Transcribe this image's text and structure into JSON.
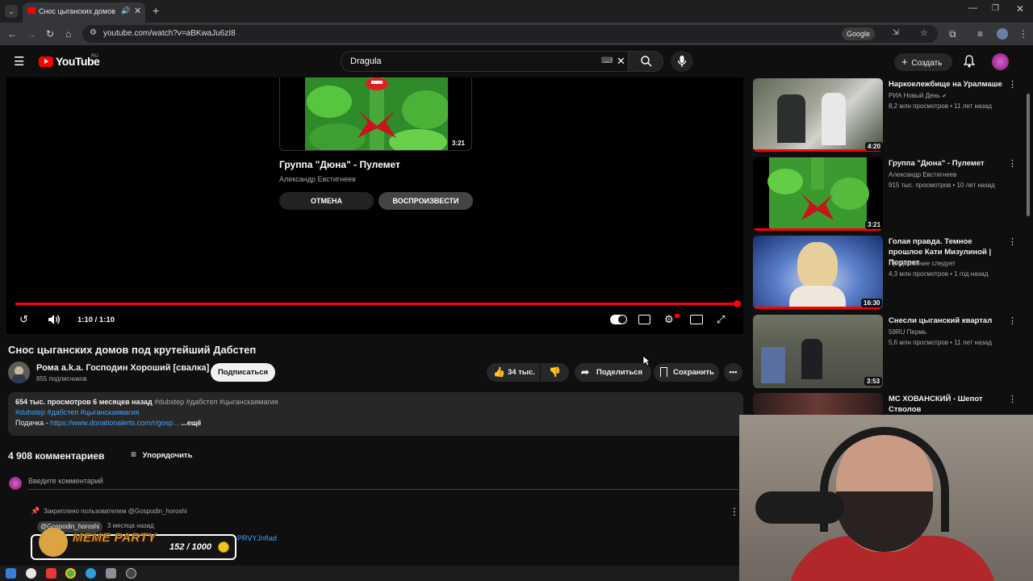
{
  "browser": {
    "tab_title": "Снос цыганских домов по",
    "url": "youtube.com/watch?v=aBKwaJu6zI8",
    "google_label": "Google"
  },
  "header": {
    "logo_text": "YouTube",
    "region": "RU",
    "search_query": "Dragula",
    "create_label": "Создать"
  },
  "player": {
    "endscreen": {
      "duration": "3:21",
      "title": "Группа \"Дюна\" - Пулемет",
      "channel": "Александр Евстигнеев",
      "cancel_label": "ОТМЕНА",
      "play_label": "ВОСПРОИЗВЕСТИ"
    },
    "time": "1:10 / 1:10",
    "progress": 1.0
  },
  "video": {
    "title": "Снос цыганских домов под крутейший Дабстеп",
    "channel": "Рома  a.k.a. Господин Хороший [свалка]",
    "subscribers": "855 подписчиков",
    "subscribe_label": "Подписаться",
    "likes": "34 тыс.",
    "share_label": "Поделиться",
    "save_label": "Сохранить"
  },
  "description": {
    "stats": "654 тыс. просмотров  6 месяцев назад",
    "stats_tags": "#dubstep #дабстеп #цыганскаямагия",
    "tags": "#dubstep #дабстеп #цыганскаямагия",
    "donation_prefix": "Подачка - ",
    "donation_link": "https://www.donationalerts.com/r/gosp...",
    "more_label": "...ещё"
  },
  "comments": {
    "count": "4 908 комментариев",
    "sort_label": "Упорядочить",
    "placeholder": "Введите комментарий",
    "pinned_note": "Закреплено пользователем @Gospodin_horoshi",
    "pinned_author": "@Gospodin_horoshi",
    "pinned_time": "3 месяца назад",
    "pinned_link": "PRVYJnfIad"
  },
  "overlay": {
    "name": "MEME PARTY",
    "counter": "152 / 1000"
  },
  "related": [
    {
      "title": "Наркоележбище на Уралмаше",
      "channel": "РИА Новый День",
      "meta": "8,2 млн просмотров • 11 лет назад",
      "duration": "4:20"
    },
    {
      "title": "Группа \"Дюна\" - Пулемет",
      "channel": "Александр Евстигнеев",
      "meta": "915 тыс. просмотров • 10 лет назад",
      "duration": "3:21"
    },
    {
      "title": "Голая правда. Темное прошлое Кати Мизулиной | Портрет",
      "channel": "Продолжение следует",
      "meta": "4,3 млн просмотров • 1 год назад",
      "duration": "16:30"
    },
    {
      "title": "Снесли цыганский квартал",
      "channel": "59RU Пермь",
      "meta": "5,6 млн просмотров • 11 лет назад",
      "duration": "3:53"
    },
    {
      "title": "МС ХОВАНСКИЙ - Шепот Стволов",
      "channel": "",
      "meta": "",
      "duration": ""
    }
  ],
  "colors": {
    "accent": "#ff0000",
    "link": "#3ea6ff",
    "bg": "#0f0f0f"
  }
}
